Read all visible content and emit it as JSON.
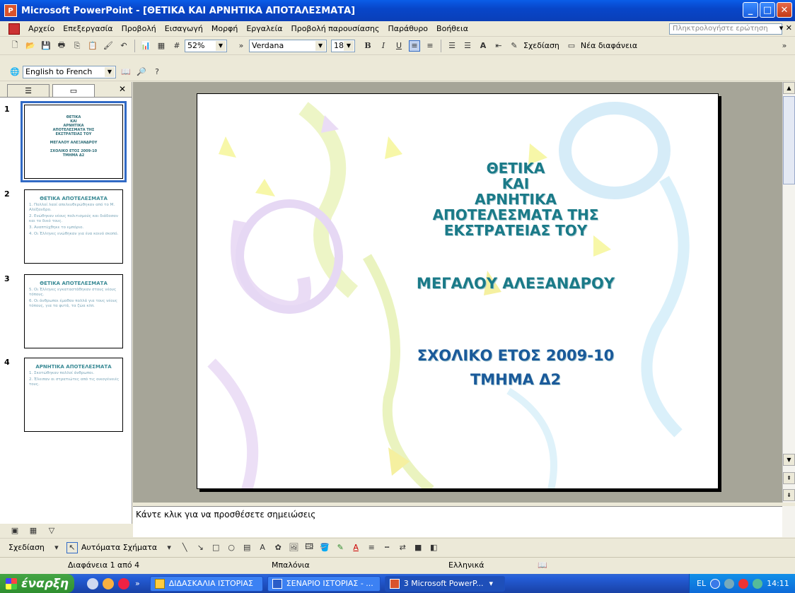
{
  "window": {
    "title": "Microsoft PowerPoint - [ΘΕΤΙΚΑ ΚΑΙ ΑΡΝΗΤΙΚΑ ΑΠΟΤΑΛΕΣΜΑΤΑ]"
  },
  "menu": {
    "items": [
      "Αρχείο",
      "Επεξεργασία",
      "Προβολή",
      "Εισαγωγή",
      "Μορφή",
      "Εργαλεία",
      "Προβολή παρουσίασης",
      "Παράθυρο",
      "Βοήθεια"
    ],
    "help_placeholder": "Πληκτρολογήστε ερώτηση"
  },
  "toolbar": {
    "zoom": "52%",
    "font": "Verdana",
    "font_size": "18",
    "design_label": "Σχεδίαση",
    "new_slide_label": "Νέα διαφάνεια",
    "translate": "English to French"
  },
  "slides_panel": {
    "thumbnails": [
      {
        "num": "1",
        "title": "ΘΕΤΙΚΑ\nΚΑΙ\nΑΡΝΗΤΙΚΑ\nΑΠΟΤΕΛΕΣΜΑΤΑ ΤΗΣ\nΕΚΣΤΡΑΤΕΙΑΣ ΤΟΥ",
        "lines": [
          "ΜΕΓΑΛΟΥ ΑΛΕΞΑΝΔΡΟΥ",
          "ΣΧΟΛΙΚΟ ΕΤΟΣ 2009-10",
          "ΤΜΗΜΑ Δ2"
        ]
      },
      {
        "num": "2",
        "title": "ΘΕΤΙΚΑ ΑΠΟΤΕΛΕΣΜΑΤΑ",
        "lines": [
          "1. Πολλοί λαοί απελευθερώθηκαν από το Μ. Αλέξανδρο.",
          "2. Ενώθηκαν νέους πολιτισμούς και διάδοσαν και το δικό τους.",
          "3. Αναπτύχθηκε το εμπόριο.",
          "4. Οι Έλληνες ενώθηκαν για ένα κοινό σκοπό."
        ]
      },
      {
        "num": "3",
        "title": "ΘΕΤΙΚΑ ΑΠΟΤΕΛΕΣΜΑΤΑ",
        "lines": [
          "5. Οι Έλληνες εγκαταστάθηκαν στους νέους τόπους.",
          "6. Οι άνθρωποι έμαθαν πολλά για τους νέους τόπους, για τα φυτά, τα ζώα κλπ."
        ]
      },
      {
        "num": "4",
        "title": "ΑΡΝΗΤΙΚΑ ΑΠΟΤΕΛΕΣΜΑΤΑ",
        "lines": [
          "1. Σκοτώθηκαν πολλοί άνθρωποι.",
          "2. Έλειπαν οι στρατιώτες από τις οικογένειές τους."
        ]
      }
    ]
  },
  "slide": {
    "title": "ΘΕΤΙΚΑ\nΚΑΙ\nΑΡΝΗΤΙΚΑ\nΑΠΟΤΕΛΕΣΜΑΤΑ ΤΗΣ\nΕΚΣΤΡΑΤΕΙΑΣ ΤΟΥ",
    "subtitle": "ΜΕΓΑΛΟΥ ΑΛΕΞΑΝΔΡΟΥ",
    "year": "ΣΧΟΛΙΚΟ ΕΤΟΣ 2009-10",
    "class": "ΤΜΗΜΑ Δ2"
  },
  "notes": {
    "placeholder": "Κάντε κλικ για να προσθέσετε σημειώσεις"
  },
  "drawbar": {
    "draw_label": "Σχεδίαση",
    "autoshapes_label": "Αυτόματα Σχήματα"
  },
  "status": {
    "slide_pos": "Διαφάνεια 1 από 4",
    "design": "Μπαλόνια",
    "language": "Ελληνικά"
  },
  "taskbar": {
    "start": "έναρξη",
    "tasks": [
      "ΔΙΔΑΣΚΑΛΙΑ ΙΣΤΟΡΙΑΣ",
      "ΣΕΝΑΡΙΟ ΙΣΤΟΡΙΑΣ - ...",
      "3 Microsoft PowerP..."
    ],
    "lang": "EL",
    "time": "14:11"
  }
}
